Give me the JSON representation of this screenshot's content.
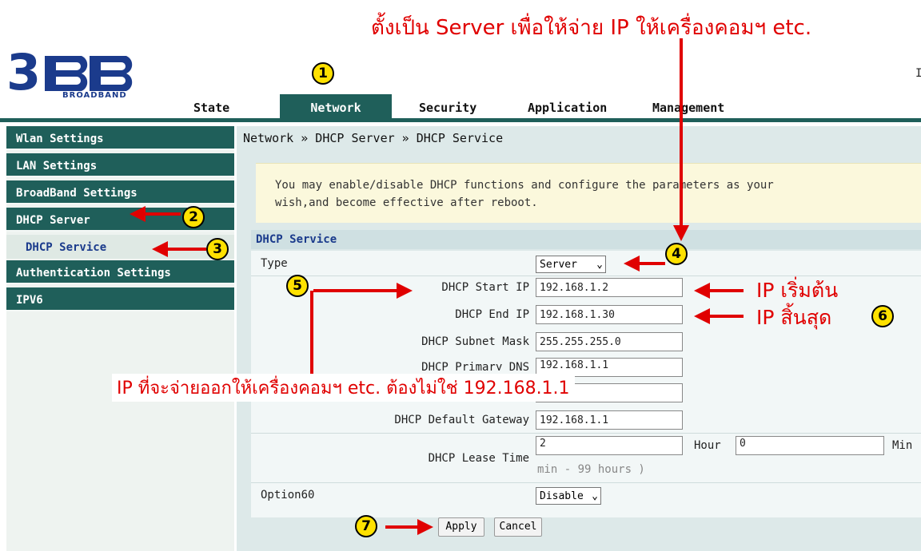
{
  "annotation": {
    "top_caption": "ตั้งเป็น Server เพื่อให้จ่าย  IP ให้เครื่องคอมฯ etc.",
    "bottom_caption": "IP ที่จะจ่ายออกให้เครื่องคอมฯ etc. ต้องไม่ใช่ 192.168.1.1",
    "start_label": "IP เริ่มต้น",
    "end_label": "IP สิ้นสุด",
    "badges": [
      "1",
      "2",
      "3",
      "4",
      "5",
      "6",
      "7"
    ],
    "color": "#e00000"
  },
  "logo": {
    "brand": "3BB",
    "tagline": "BROADBAND"
  },
  "topnav": {
    "tabs": [
      "State",
      "Network",
      "Security",
      "Application",
      "Management"
    ],
    "active": "Network",
    "edge_text": "I"
  },
  "sidebar": {
    "items": [
      "Wlan Settings",
      "LAN Settings",
      "BroadBand Settings",
      "DHCP Server",
      "DHCP Service",
      "Authentication Settings",
      "IPV6"
    ]
  },
  "breadcrumb": "Network » DHCP Server » DHCP Service",
  "notice": {
    "line1": "You may enable/disable DHCP functions and configure the parameters as your",
    "line2": "wish,and become effective after reboot."
  },
  "section_title": "DHCP Service",
  "form": {
    "type_label": "Type",
    "type_value": "Server",
    "start_ip_label": "DHCP Start IP",
    "start_ip": "192.168.1.2",
    "end_ip_label": "DHCP End IP",
    "end_ip": "192.168.1.30",
    "subnet_label": "DHCP Subnet Mask",
    "subnet": "255.255.255.0",
    "dns_label": "DHCP Primary DNS",
    "dns": "192.168.1.1",
    "gateway_label": "DHCP Default Gateway",
    "gateway": "192.168.1.1",
    "lease_label": "DHCP Lease Time",
    "lease_hours": "2",
    "hour_label": "Hour",
    "lease_min": "0",
    "min_label": "Min",
    "lease_hint": "min - 99 hours )",
    "option60_label": "Option60",
    "option60_value": "Disable"
  },
  "buttons": {
    "apply": "Apply",
    "cancel": "Cancel"
  },
  "colors": {
    "nav": "#1f5f5a",
    "notice_bg": "#fbf8dc",
    "panel": "#dde9e9"
  }
}
